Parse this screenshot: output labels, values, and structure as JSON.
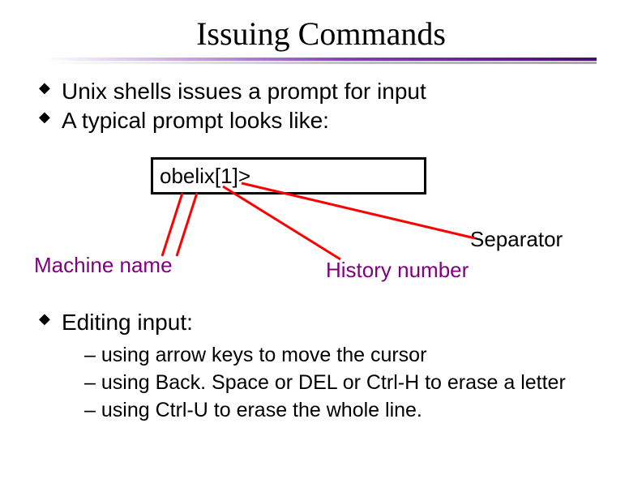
{
  "title": "Issuing Commands",
  "bullets": {
    "b1": "Unix shells issues a prompt for input",
    "b2": "A typical prompt looks like:"
  },
  "prompt": "obelix[1]>",
  "labels": {
    "machine": "Machine name",
    "history": "History number",
    "separator": "Separator"
  },
  "editing": {
    "heading": "Editing input:",
    "s1": "using arrow keys to move the cursor",
    "s2": "using Back. Space or DEL or Ctrl-H to erase a letter",
    "s3": "using Ctrl-U to erase the whole line."
  },
  "colors": {
    "purple": "#800080",
    "red": "#ff0000"
  }
}
